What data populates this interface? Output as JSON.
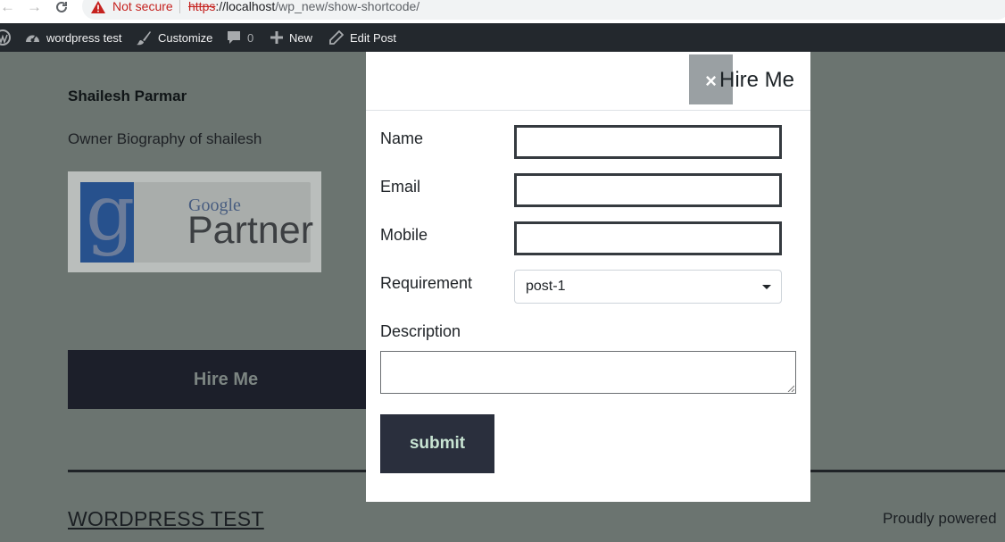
{
  "browser": {
    "not_secure": "Not secure",
    "url_protocol": "https",
    "url_host": "://localhost",
    "url_path": "/wp_new/show-shortcode/"
  },
  "adminbar": {
    "site_name": "wordpress test",
    "customize": "Customize",
    "comments_count": "0",
    "new": "New",
    "edit_post": "Edit Post"
  },
  "page": {
    "author_name": "Shailesh Parmar",
    "author_bio": "Owner Biography of shailesh",
    "partner_google": "Google",
    "partner_word": "Partner",
    "hire_button": "Hire Me",
    "site_title": "WORDPRESS TEST",
    "powered": "Proudly powered"
  },
  "modal": {
    "close_symbol": "×",
    "title": "Hire Me",
    "labels": {
      "name": "Name",
      "email": "Email",
      "mobile": "Mobile",
      "requirement": "Requirement",
      "description": "Description"
    },
    "values": {
      "name": "",
      "email": "",
      "mobile": "",
      "description": ""
    },
    "requirement_selected": "post-1",
    "submit": "submit"
  },
  "icons": [
    "back-arrow-icon",
    "forward-arrow-icon",
    "reload-icon",
    "warning-icon",
    "wordpress-logo-icon",
    "dashboard-icon",
    "brush-icon",
    "comment-icon",
    "plus-icon",
    "pencil-icon",
    "close-icon",
    "chevron-down-icon"
  ],
  "colors": {
    "overlay_bg": "#6b7470",
    "adminbar": "#23282d",
    "hire_button": "#1c1f2a",
    "submit_button": "#2a2f3d",
    "not_secure": "#c5221f"
  }
}
